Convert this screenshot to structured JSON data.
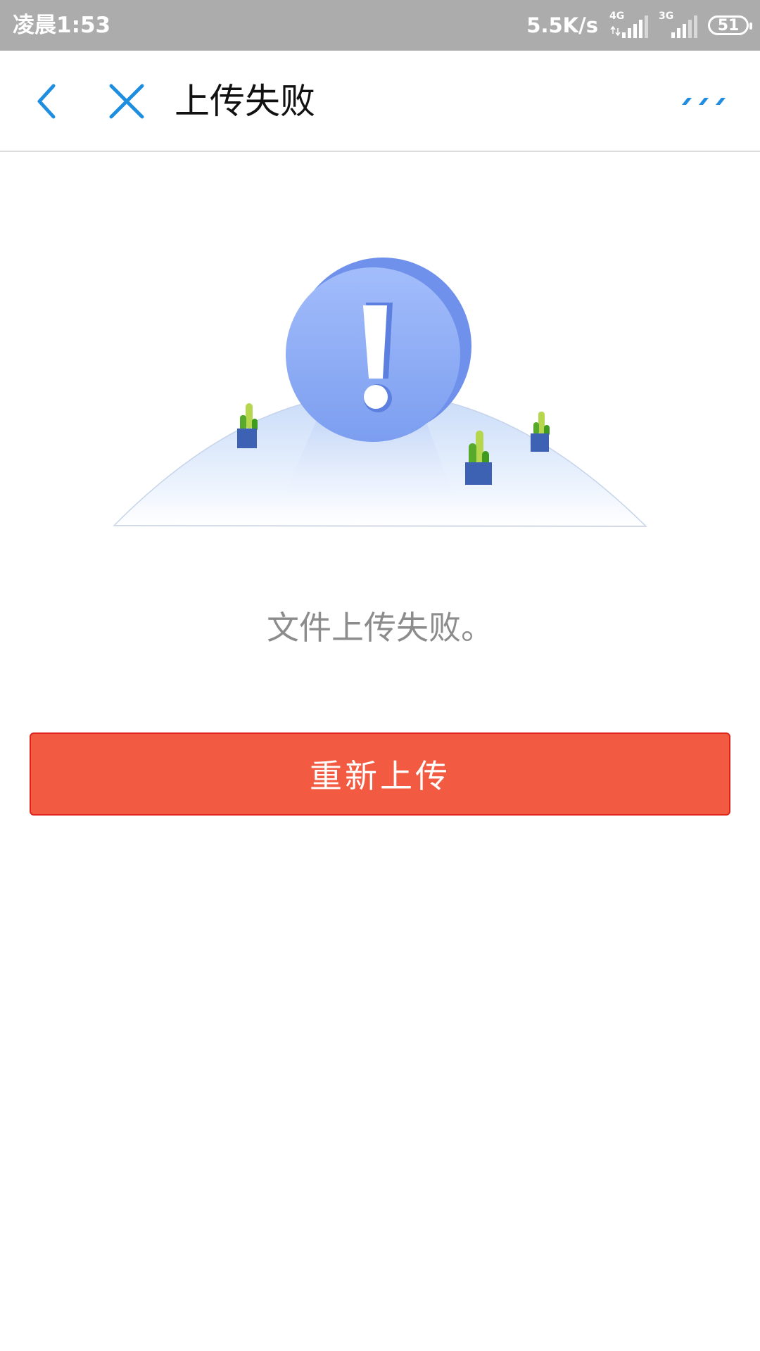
{
  "status_bar": {
    "time": "凌晨1:53",
    "net_speed": "5.5K/s",
    "signal_1_type": "4G",
    "signal_2_type": "3G",
    "battery": "51"
  },
  "nav": {
    "back_icon": "chevron-left-icon",
    "close_icon": "close-icon",
    "title": "上传失败",
    "more_icon": "more-dots-icon"
  },
  "illustration": {
    "icon": "warning-exclamation-illustration"
  },
  "message": "文件上传失败。",
  "retry_button_label": "重新上传",
  "colors": {
    "accent_blue": "#1f8ee0",
    "button_red": "#f25b41",
    "button_border": "#e0231c",
    "status_bar_bg": "#acacac",
    "message_gray": "#8c8c8c"
  }
}
